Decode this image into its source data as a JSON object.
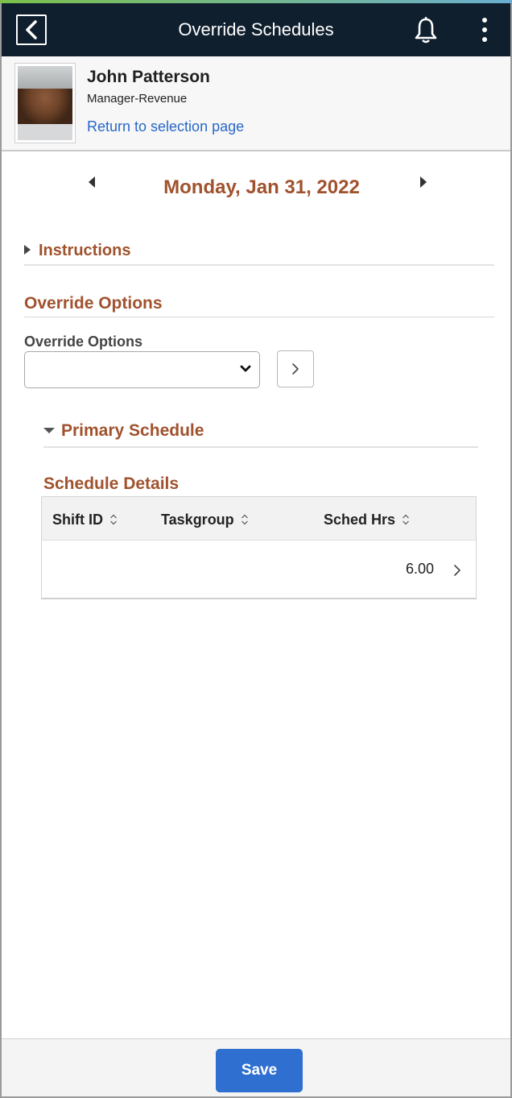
{
  "header": {
    "title": "Override Schedules",
    "back_icon": "chevron-left-icon",
    "bell_icon": "bell-icon",
    "menu_icon": "kebab-menu-icon"
  },
  "employee": {
    "name": "John Patterson",
    "job_title": "Manager-Revenue",
    "return_link": "Return to selection page"
  },
  "date_nav": {
    "date": "Monday, Jan 31, 2022"
  },
  "instructions": {
    "label": "Instructions",
    "expanded": false
  },
  "override": {
    "section_title": "Override Options",
    "field_label": "Override Options",
    "selected_value": ""
  },
  "primary_schedule": {
    "label": "Primary Schedule",
    "expanded": true,
    "details_title": "Schedule Details",
    "columns": [
      "Shift ID",
      "Taskgroup",
      "Sched Hrs"
    ],
    "rows": [
      {
        "shift_id": "",
        "taskgroup": "",
        "sched_hrs": "6.00"
      }
    ]
  },
  "footer": {
    "save_label": "Save"
  },
  "colors": {
    "accent_text": "#a0522d",
    "topbar_bg": "#101f2e",
    "link": "#2967c8",
    "primary_button": "#2f6fcf"
  }
}
